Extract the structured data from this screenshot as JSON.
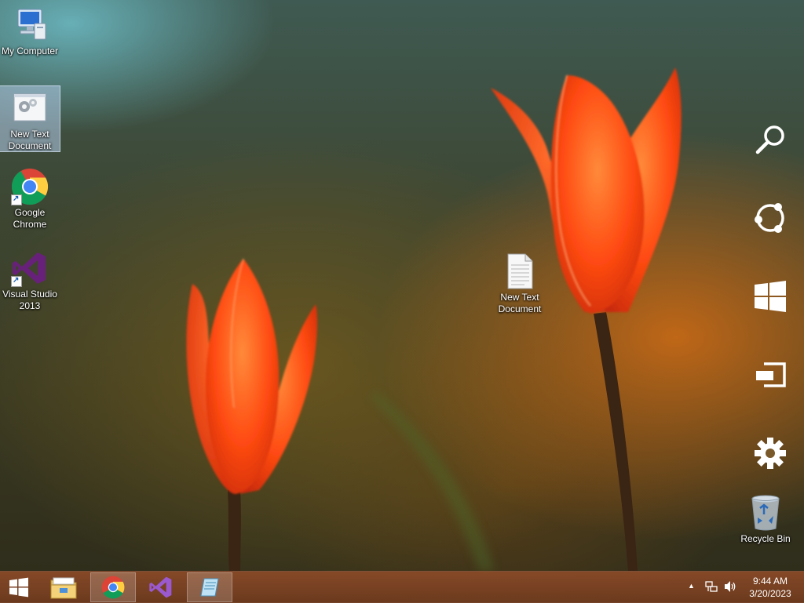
{
  "desktop": {
    "icons": [
      {
        "label": "My Computer",
        "icon": "computer-icon"
      },
      {
        "label": "New Text Document",
        "icon": "settings-document-icon",
        "selected": true
      },
      {
        "label": "Google Chrome",
        "icon": "chrome-icon",
        "shortcut": true
      },
      {
        "label": "Visual Studio 2013",
        "icon": "visual-studio-icon",
        "shortcut": true
      },
      {
        "label": "New Text Document",
        "icon": "text-document-icon"
      },
      {
        "label": "Recycle Bin",
        "icon": "recycle-bin-icon"
      }
    ]
  },
  "charms": [
    "search-icon",
    "share-icon",
    "start-icon",
    "devices-icon",
    "settings-icon"
  ],
  "taskbar": {
    "items": [
      "windows-start-icon",
      "file-explorer-icon",
      "chrome-icon",
      "visual-studio-icon",
      "notepad-icon"
    ],
    "active": [
      "chrome-icon",
      "notepad-icon"
    ],
    "tray": {
      "show_hidden": "▲",
      "time": "9:44 AM",
      "date": "3/20/2023"
    }
  },
  "colors": {
    "taskbar": "#8a4a28",
    "selection": "#b4cdeb",
    "tulip": "#ff4a12"
  }
}
